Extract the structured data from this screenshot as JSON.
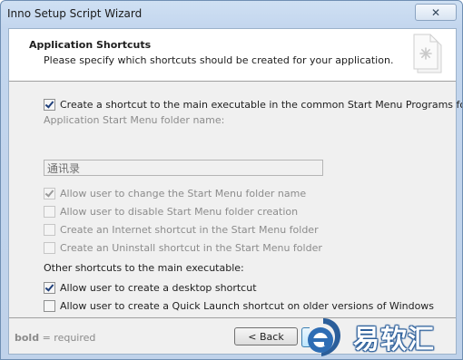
{
  "window": {
    "title": "Inno Setup Script Wizard"
  },
  "header": {
    "title": "Application Shortcuts",
    "subtitle": "Please specify which shortcuts should be created for your application."
  },
  "options": {
    "start_menu_shortcut": {
      "label": "Create a shortcut to the main executable in the common Start Menu Programs folder",
      "checked": true
    },
    "folder_name_label": "Application Start Menu folder name:",
    "folder_name_value": "通讯录",
    "allow_change_folder": {
      "label": "Allow user to change the Start Menu folder name",
      "checked": true
    },
    "allow_disable_folder": {
      "label": "Allow user to disable Start Menu folder creation",
      "checked": false
    },
    "internet_shortcut": {
      "label": "Create an Internet shortcut in the Start Menu folder",
      "checked": false
    },
    "uninstall_shortcut": {
      "label": "Create an Uninstall shortcut in the Start Menu folder",
      "checked": false
    },
    "other_heading": "Other shortcuts to the main executable:",
    "desktop_shortcut": {
      "label": "Allow user to create a desktop shortcut",
      "checked": true
    },
    "quicklaunch_shortcut": {
      "label": "Allow user to create a Quick Launch shortcut on older versions of Windows",
      "checked": false
    }
  },
  "footer": {
    "note_bold": "bold",
    "note_rest": " = required",
    "back_label": "< Back"
  },
  "watermark": {
    "text": "易软汇"
  },
  "colors": {
    "titlebar": "#c3d6ee",
    "watermark_blue": "#2b5e9a",
    "dialog_bg": "#f0f0f0"
  },
  "icons": {
    "close": "close-icon",
    "wizard": "wizard-page-icon",
    "watermark": "watermark-logo-icon"
  }
}
